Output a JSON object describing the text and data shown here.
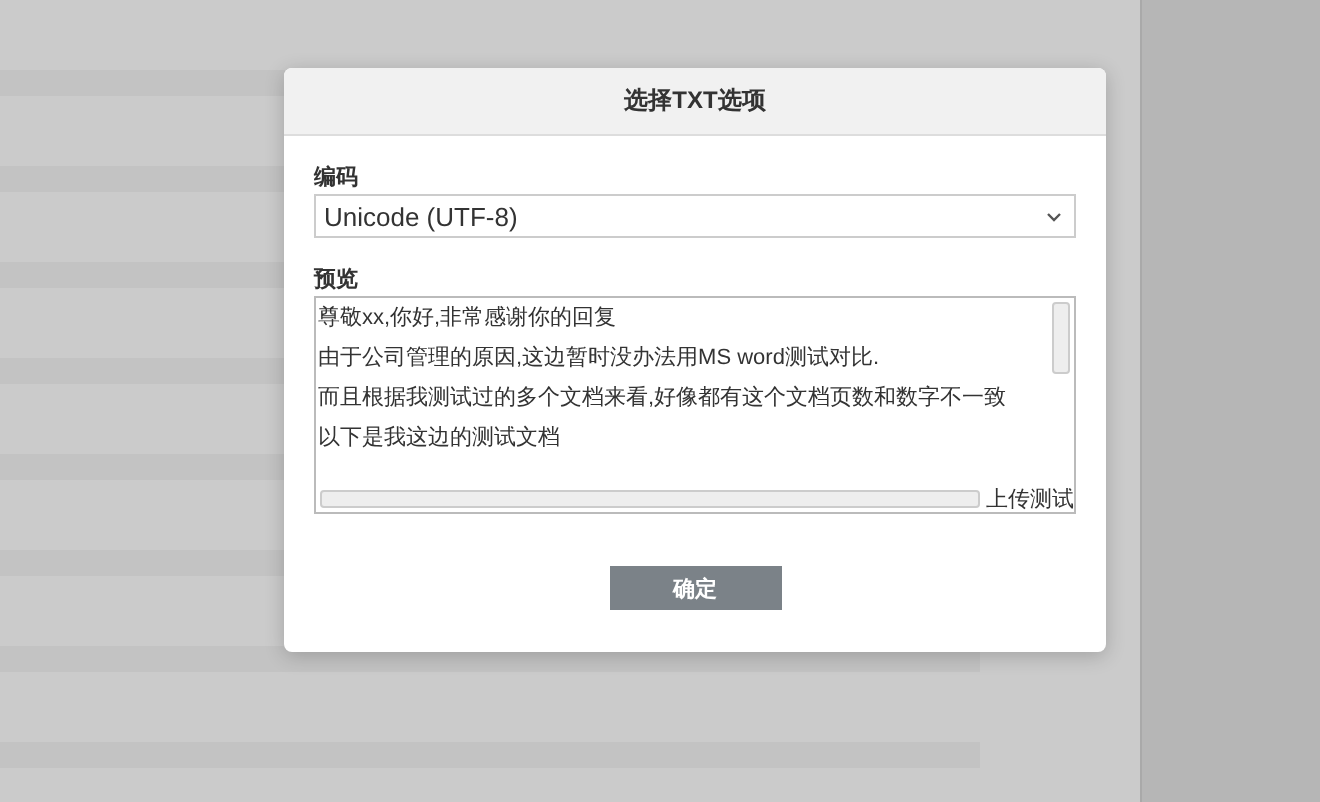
{
  "dialog": {
    "title": "选择TXT选项",
    "encoding": {
      "label": "编码",
      "value": "Unicode (UTF-8)"
    },
    "preview": {
      "label": "预览",
      "lines": [
        "尊敬xx,你好,非常感谢你的回复",
        "由于公司管理的原因,这边暂时没办法用MS word测试对比.",
        "而且根据我测试过的多个文档来看,好像都有这个文档页数和数字不一致",
        "以下是我这边的测试文档"
      ],
      "last_line_visible": "上传测试"
    },
    "buttons": [
      "确定"
    ]
  }
}
